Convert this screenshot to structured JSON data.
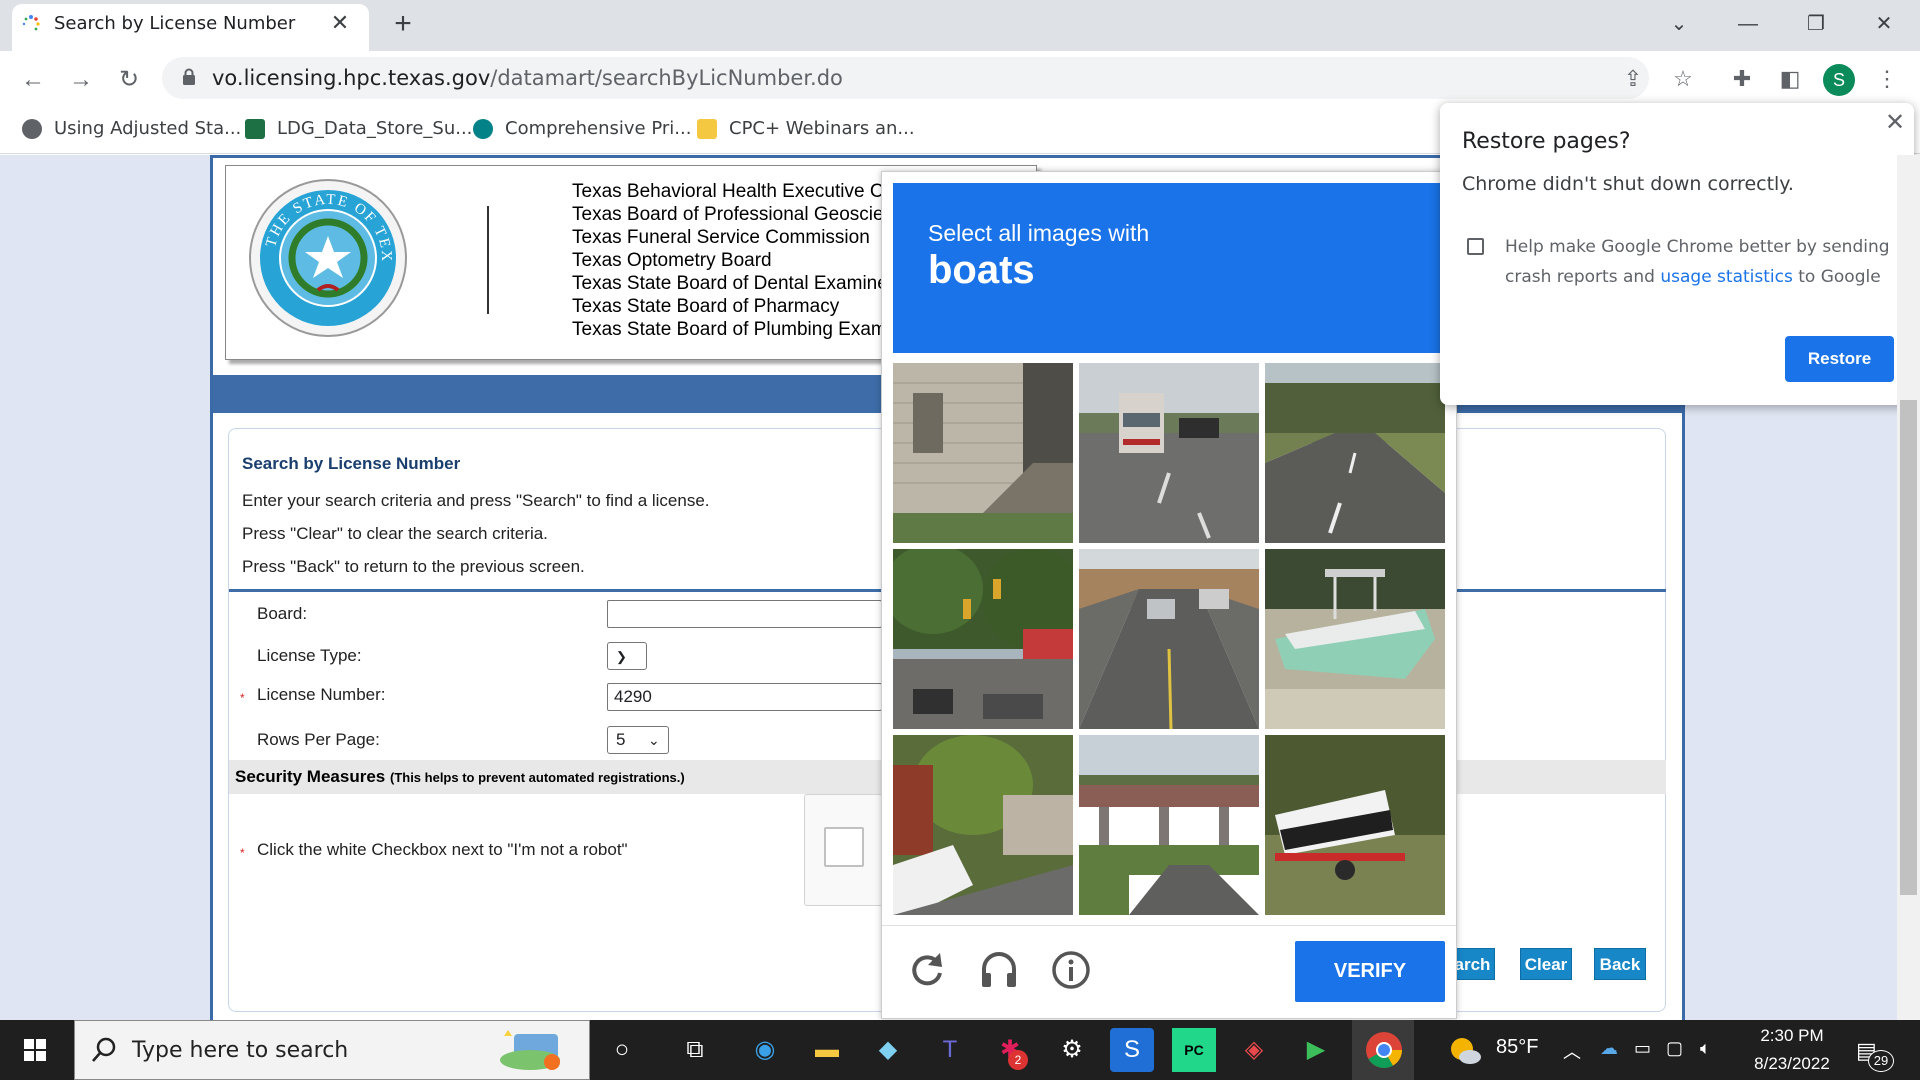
{
  "browser": {
    "tab_title": "Search by License Number",
    "tab_close": "✕",
    "new_tab": "+",
    "url_domain": "vo.licensing.hpc.texas.gov",
    "url_path": "/datamart/searchByLicNumber.do",
    "profile_initial": "S",
    "bookmarks": [
      {
        "label": "Using Adjusted Sta...",
        "icon": "globe-icon"
      },
      {
        "label": "LDG_Data_Store_Su...",
        "icon": "excel-icon"
      },
      {
        "label": "Comprehensive Pri...",
        "icon": "sharepoint-icon"
      },
      {
        "label": "CPC+ Webinars an...",
        "icon": "folder-icon"
      }
    ]
  },
  "banner": {
    "seal_text": "THE STATE OF TEXAS",
    "agencies": [
      {
        "pre": "Texas ",
        "big": "Behavioral Health",
        "post": " Executive Co"
      },
      {
        "pre": "Texas Board of Professional ",
        "big": "Geoscient",
        "post": ""
      },
      {
        "pre": "Texas ",
        "big": "Funeral",
        "post": " Service Commission"
      },
      {
        "pre": "Texas ",
        "big": "Optometry",
        "post": " Board"
      },
      {
        "pre": "Texas State Board of ",
        "big": "Dental",
        "post": " Examiners"
      },
      {
        "pre": "Texas State Board of ",
        "big": "Pharmacy",
        "post": ""
      },
      {
        "pre": "Texas State Board of ",
        "big": "Plumbing",
        "post": " Examir"
      }
    ]
  },
  "form": {
    "title": "Search by License Number",
    "instructions": [
      "Enter your search criteria and press \"Search\" to find a license.",
      "Press \"Clear\" to clear the search criteria.",
      "Press \"Back\" to return to the previous screen."
    ],
    "board_label": "Board:",
    "board_value": "",
    "license_type_label": "License Type:",
    "license_type_value": "",
    "license_number_label": "License Number:",
    "license_number_value": "4290",
    "rows_label": "Rows Per Page:",
    "rows_value": "5",
    "security_title": "Security Measures",
    "security_note": "(This helps to prevent automated registrations.)",
    "robot_label": "Click the white Checkbox next to \"I'm not a robot\"",
    "required_mark": "*",
    "search_btn": "arch",
    "clear_btn": "Clear",
    "back_btn": "Back"
  },
  "captcha": {
    "prompt": "Select all images with",
    "keyword": "boats",
    "verify_label": "VERIFY",
    "tiles": [
      "house-porch",
      "street-bus",
      "empty-road",
      "intersection-cars",
      "road-car",
      "boat-trailer",
      "yard-boat",
      "overpass",
      "boat-on-trailer"
    ]
  },
  "restore_popup": {
    "title": "Restore pages?",
    "message": "Chrome didn't shut down correctly.",
    "help_pre": "Help make Google Chrome better by sending crash reports and ",
    "help_link": "usage statistics",
    "help_post": " to Google",
    "restore_btn": "Restore"
  },
  "taskbar": {
    "search_placeholder": "Type here to search",
    "weather": "85°F",
    "time": "2:30 PM",
    "date": "8/23/2022",
    "notifications": "29",
    "slack_badge": "2"
  },
  "colors": {
    "chrome_blue": "#1a73e8",
    "page_blue": "#3d6ca8",
    "form_button": "#1787c8"
  }
}
